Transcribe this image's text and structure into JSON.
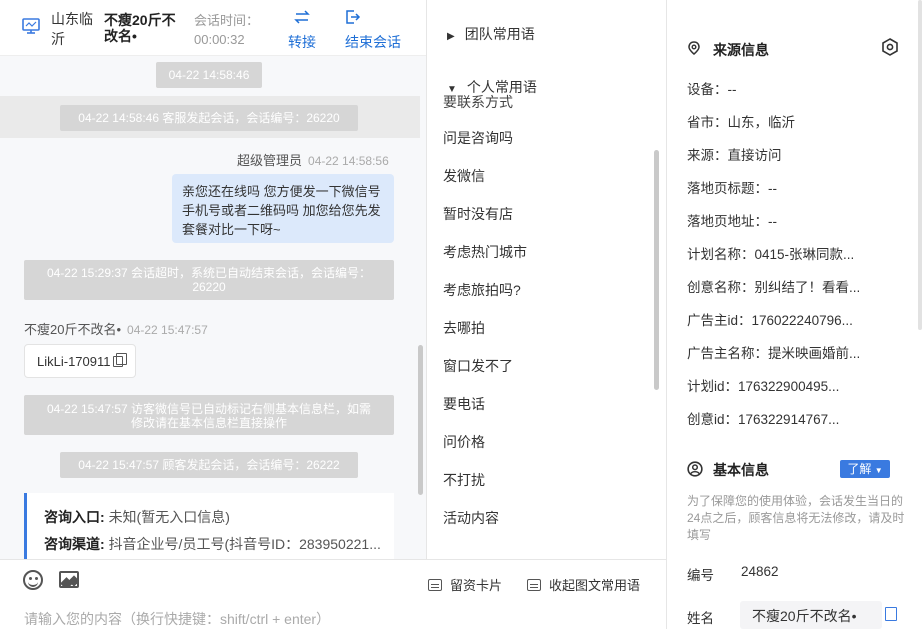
{
  "header": {
    "location": "山东临沂",
    "nickname": "不瘦20斤不改名•",
    "time_label": "会话时间：",
    "time_value": "00:00:32",
    "transfer_label": "转接",
    "end_label": "结束会话"
  },
  "chat": {
    "msg_time_1": "04-22 14:58:46",
    "sys_start_1": "04-22 14:58:46 客服发起会话，会话编号：26220",
    "agent_name": "超级管理员",
    "agent_time": "04-22 14:58:56",
    "agent_msg": "亲您还在线吗 您方便发一下微信号 手机号或者二维码吗 加您给您先发套餐对比一下呀~",
    "sys_timeout_line1": "04-22 15:29:37 会话超时，系统已自动结束会话，会话编号：",
    "sys_timeout_line2": "26220",
    "visitor_name": "不瘦20斤不改名•",
    "visitor_time": "04-22 15:47:57",
    "visitor_chip": "LikLi-170911",
    "sys_wechat_line1": "04-22 15:47:57 访客微信号已自动标记右侧基本信息栏，如需",
    "sys_wechat_line2": "修改请在基本信息栏直接操作",
    "sys_start_2": "04-22 15:47:57 顾客发起会话，会话编号：26222",
    "card_entry_label": "咨询入口:",
    "card_entry_value": "未知(暂无入口信息)",
    "card_channel_label": "咨询渠道:",
    "card_channel_value": "抖音企业号/员工号(抖音号ID：283950221..."
  },
  "composer": {
    "placeholder": "请输入您的内容（换行快捷键：shift/ctrl + enter）",
    "card_button": "留资卡片",
    "collapse_button": "收起图文常用语"
  },
  "phrases": {
    "team_group": "团队常用语",
    "personal_group": "个人常用语",
    "partial_item": "要联系方式",
    "items": [
      "问是咨询吗",
      "发微信",
      "暂时没有店",
      "考虑热门城市",
      "考虑旅拍吗?",
      "去哪拍",
      "窗口发不了",
      "要电话",
      "问价格",
      "不打扰",
      "活动内容"
    ]
  },
  "info": {
    "source_title": "来源信息",
    "rows": [
      "设备：--",
      "省市：山东，临沂",
      "来源：直接访问",
      "落地页标题：--",
      "落地页地址：--",
      "计划名称：0415-张琳同款...",
      "创意名称：别纠结了！看看...",
      "广告主id：176022240796...",
      "广告主名称：提米映画婚前...",
      "计划id：176322900495...",
      "创意id：176322914767..."
    ],
    "basic_title": "基本信息",
    "learn_label": "了解",
    "notice": "为了保障您的使用体验，会话发生当日的24点之后，顾客信息将无法修改，请及时填写",
    "id_label": "编号",
    "id_value": "24862",
    "name_label": "姓名",
    "name_value": "不瘦20斤不改名•"
  },
  "colors": {
    "accent": "#1f6fd6",
    "bubble": "#dce9fb",
    "system_tag": "#d6d6d6"
  }
}
